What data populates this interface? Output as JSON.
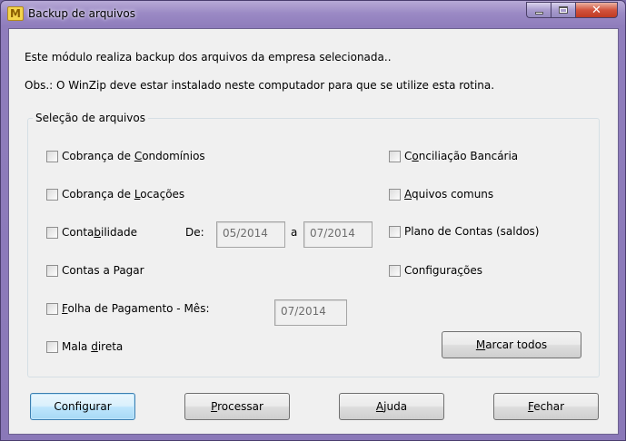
{
  "window": {
    "title": "Backup de arquivos",
    "app_icon_letter": "M",
    "controls": {
      "minimize": "minimize-icon",
      "maximize": "maximize-icon",
      "close": "✕"
    }
  },
  "info": {
    "line1": "Este módulo realiza backup dos arquivos da empresa selecionada..",
    "line2": "Obs.: O WinZip deve estar instalado neste computador para que se utilize esta rotina."
  },
  "group": {
    "title": "Seleção de arquivos",
    "left_checkboxes": [
      {
        "pre": "Cobrança de ",
        "key": "C",
        "post": "ondomínios",
        "checked": false
      },
      {
        "pre": "Cobrança de ",
        "key": "L",
        "post": "ocações",
        "checked": false
      },
      {
        "pre": "Conta",
        "key": "b",
        "post": "ilidade",
        "checked": false
      },
      {
        "pre": "Contas a Pagar",
        "key": "",
        "post": "",
        "checked": false
      },
      {
        "pre": "",
        "key": "F",
        "post": "olha de Pagamento - Mês:",
        "checked": false
      },
      {
        "pre": "Mala ",
        "key": "d",
        "post": "ireta",
        "checked": false
      }
    ],
    "right_checkboxes": [
      {
        "pre": "C",
        "key": "o",
        "post": "nciliação Bancária",
        "checked": false
      },
      {
        "pre": "",
        "key": "A",
        "post": "quivos comuns",
        "checked": false
      },
      {
        "pre": "Plano de Contas (saldos)",
        "key": "",
        "post": "",
        "checked": false
      },
      {
        "pre": "Configura",
        "key": "ç",
        "post": "ões",
        "checked": false
      }
    ],
    "de_label": "De:",
    "a_label": "a",
    "date_from": "05/2014",
    "date_to": "07/2014",
    "folha_month": "07/2014",
    "marcar_todos": {
      "pre": "",
      "key": "M",
      "post": "arcar todos"
    }
  },
  "buttons": {
    "configurar": "Configurar",
    "processar": {
      "pre": "",
      "key": "P",
      "post": "rocessar"
    },
    "ajuda": {
      "pre": "",
      "key": "A",
      "post": "juda"
    },
    "fechar": {
      "pre": "",
      "key": "F",
      "post": "echar"
    }
  }
}
